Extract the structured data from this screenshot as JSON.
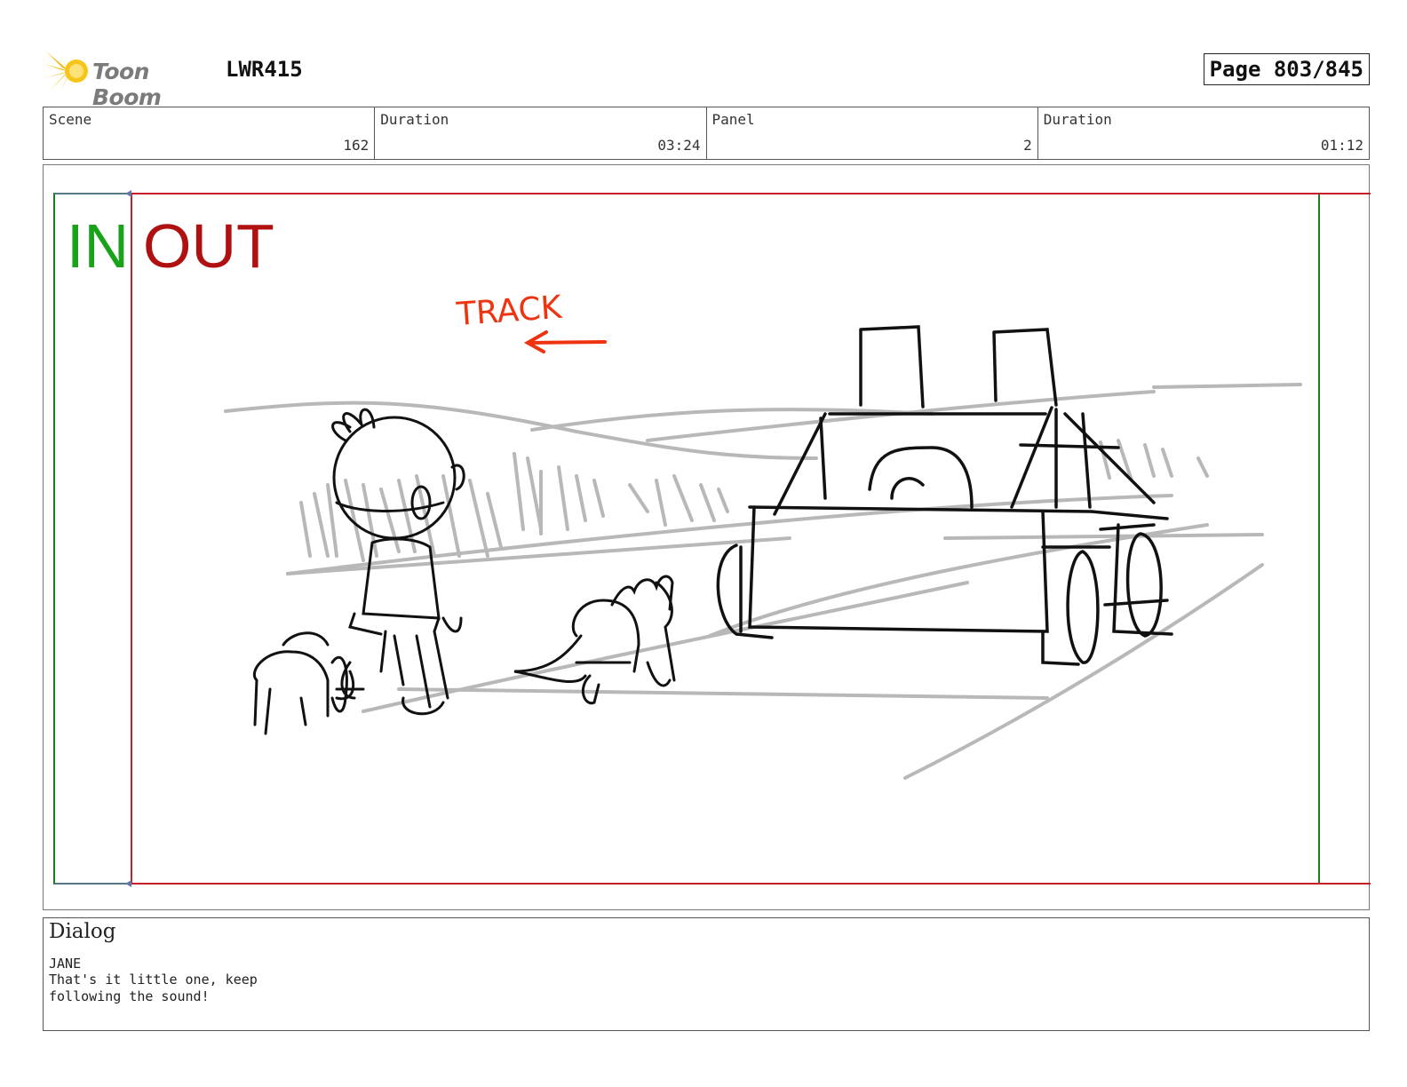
{
  "header": {
    "logo_text": "Toon Boom",
    "project_code": "LWR415",
    "page_label": "Page 803/845"
  },
  "meta": {
    "scene_label": "Scene",
    "scene_value": "162",
    "scene_duration_label": "Duration",
    "scene_duration_value": "03:24",
    "panel_label": "Panel",
    "panel_value": "2",
    "panel_duration_label": "Duration",
    "panel_duration_value": "01:12"
  },
  "panel": {
    "in_label": "IN",
    "out_label": "OUT",
    "camera_note": "TRACK",
    "colors": {
      "in": "#1aa31a",
      "out": "#b01010",
      "note": "#ee3311",
      "frame_red": "#c8202a",
      "frame_green": "#1e7a1e"
    }
  },
  "dialog": {
    "title": "Dialog",
    "speaker": "JANE",
    "lines": [
      "That's it little one, keep",
      "following the sound!"
    ]
  }
}
